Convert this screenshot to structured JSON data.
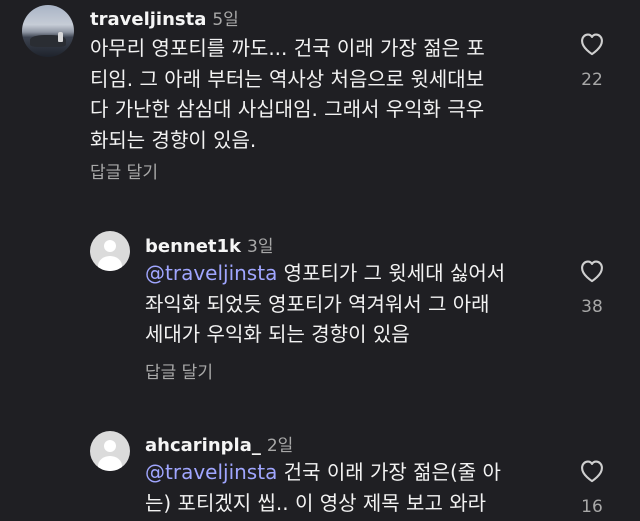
{
  "comments": [
    {
      "username": "traveljinsta",
      "time": "5일",
      "lines": [
        "아무리 영포티를 까도... 건국 이래 가장 젊은 포",
        "티임. 그 아래 부터는 역사상 처음으로 윗세대보",
        "다 가난한 삼심대 사십대임. 그래서 우익화 극우",
        "화되는 경향이 있음."
      ],
      "reply_label": "답글 달기",
      "likes": "22",
      "avatar": "beach-photo"
    },
    {
      "username": "bennet1k",
      "time": "3일",
      "mention": "@traveljinsta",
      "lines": [
        " 영포티가 그 윗세대 싫어서",
        "좌익화 되었듯 영포티가 역겨워서 그 아래",
        "세대가 우익화 되는 경향이 있음"
      ],
      "reply_label": "답글 달기",
      "likes": "38",
      "avatar": "default-profile"
    },
    {
      "username": "ahcarinpla_",
      "time": "2일",
      "mention": "@traveljinsta",
      "lines": [
        " 건국 이래 가장 젊은(줄 아",
        "는) 포티겠지 씹.. 이 영상 제목 보고 와라"
      ],
      "likes": "16",
      "avatar": "default-profile"
    }
  ],
  "icons": {
    "like": "heart-outline-icon"
  },
  "colors": {
    "background": "#1f1f23",
    "mention": "#a0a6ff",
    "secondary_text": "#a8a8a8"
  }
}
